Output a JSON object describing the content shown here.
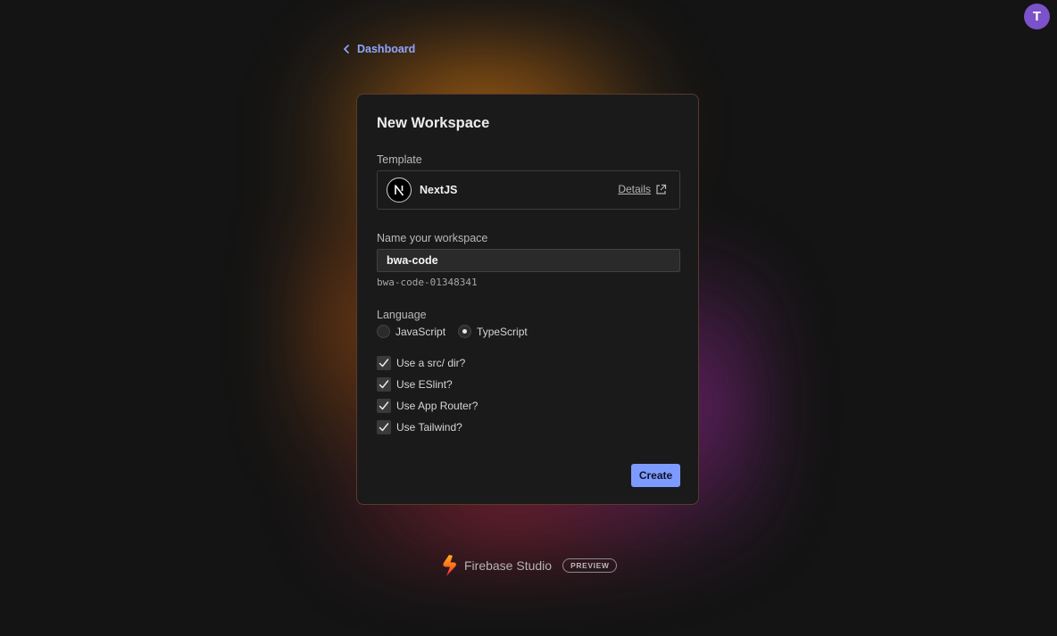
{
  "user": {
    "avatar_initial": "T"
  },
  "nav": {
    "back_label": "Dashboard"
  },
  "form": {
    "title": "New Workspace",
    "template_label": "Template",
    "template": {
      "name": "NextJS",
      "details_label": "Details",
      "icon": "nextjs-logo"
    },
    "name_label": "Name your workspace",
    "name_value": "bwa-code",
    "workspace_id": "bwa-code-01348341",
    "language_label": "Language",
    "languages": [
      {
        "label": "JavaScript",
        "selected": false
      },
      {
        "label": "TypeScript",
        "selected": true
      }
    ],
    "options": [
      {
        "label": "Use a src/ dir?",
        "checked": true
      },
      {
        "label": "Use ESlint?",
        "checked": true
      },
      {
        "label": "Use App Router?",
        "checked": true
      },
      {
        "label": "Use Tailwind?",
        "checked": true
      }
    ],
    "create_label": "Create"
  },
  "footer": {
    "brand_name": "Firebase Studio",
    "badge": "PREVIEW"
  },
  "colors": {
    "accent": "#7d9bff",
    "link": "#8fa6ff",
    "avatar": "#7b52c9",
    "background": "#141414",
    "card": "#1a1a1b"
  }
}
